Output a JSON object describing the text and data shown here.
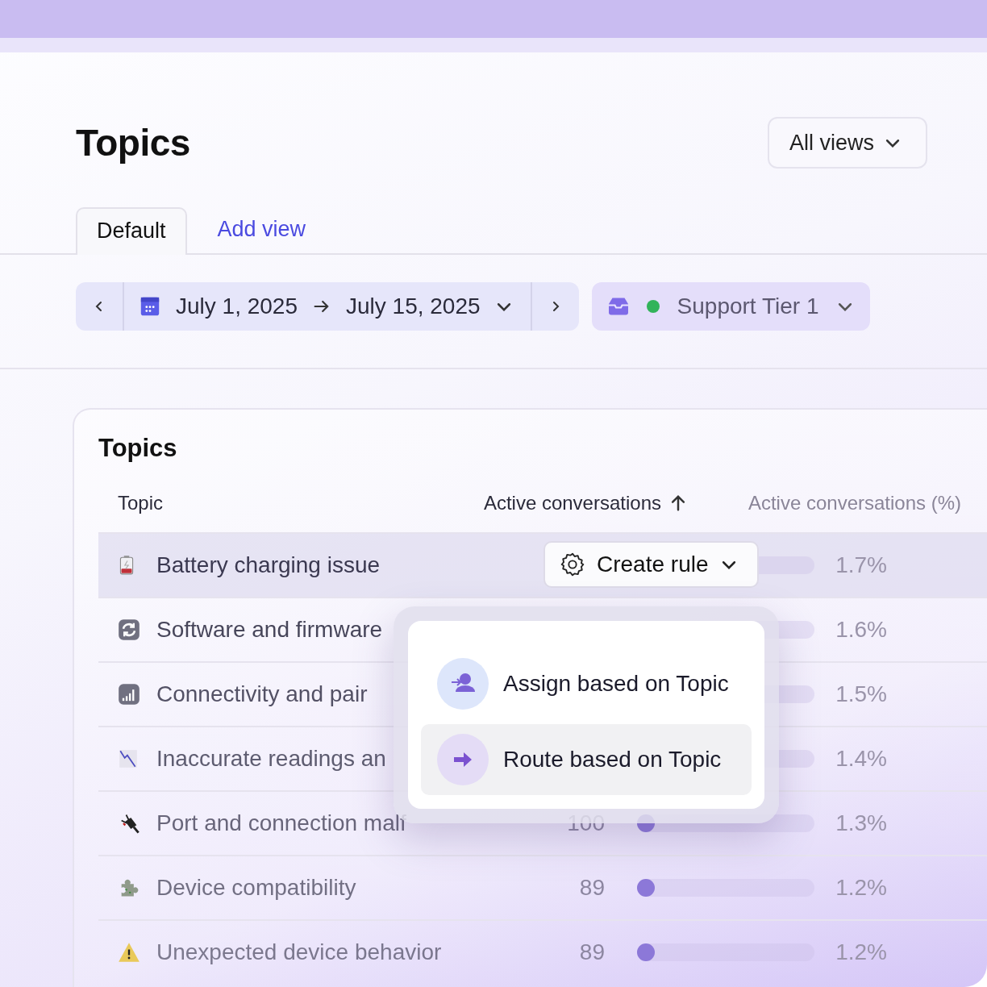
{
  "page_title": "Topics",
  "views_button": "All views",
  "tabs": [
    {
      "label": "Default",
      "selected": true
    },
    {
      "label": "Add view",
      "selected": false
    }
  ],
  "date_range": {
    "start": "July 1, 2025",
    "end": "July 15, 2025"
  },
  "inbox_filter": {
    "label": "Support Tier 1"
  },
  "table": {
    "title": "Topics",
    "columns": [
      {
        "label": "Topic",
        "sorted": false
      },
      {
        "label": "Active conversations",
        "sorted": true
      },
      {
        "label": "Active conversations (%)",
        "sorted": false
      }
    ],
    "rows": [
      {
        "topic": "Battery charging issue",
        "selected": true,
        "percent": "1.7%"
      },
      {
        "topic": "Software and firmware",
        "selected": false,
        "percent": "1.6%"
      },
      {
        "topic": "Connectivity and pair",
        "selected": false,
        "percent": "1.5%"
      },
      {
        "topic": "Inaccurate readings an",
        "selected": false,
        "percent": "1.4%"
      },
      {
        "topic": "Port and connection malf",
        "selected": false,
        "count": "100",
        "level": 0.04,
        "percent": "1.3%"
      },
      {
        "topic": "Device compatibility",
        "selected": false,
        "count": "89",
        "level": 0.04,
        "percent": "1.2%"
      },
      {
        "topic": "Unexpected device behavior",
        "selected": false,
        "count": "89",
        "level": 0.04,
        "percent": "1.2%"
      }
    ]
  },
  "row_menu": {
    "button": "Create rule",
    "items": [
      {
        "label": "Assign based on Topic",
        "selected": false
      },
      {
        "label": "Route based on Topic",
        "selected": true
      }
    ]
  }
}
